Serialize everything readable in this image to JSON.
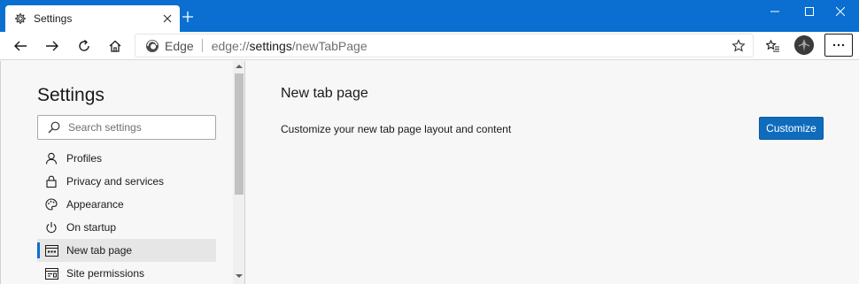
{
  "tab": {
    "title": "Settings"
  },
  "toolbar": {
    "site_name": "Edge",
    "url_prefix": "edge://",
    "url_main": "settings",
    "url_suffix": "/newTabPage"
  },
  "sidebar": {
    "title": "Settings",
    "search_placeholder": "Search settings",
    "items": [
      {
        "label": "Profiles",
        "icon": "person-icon"
      },
      {
        "label": "Privacy and services",
        "icon": "lock-icon"
      },
      {
        "label": "Appearance",
        "icon": "palette-icon"
      },
      {
        "label": "On startup",
        "icon": "power-icon"
      },
      {
        "label": "New tab page",
        "icon": "newtab-icon",
        "active": true
      },
      {
        "label": "Site permissions",
        "icon": "site-permissions-icon"
      }
    ]
  },
  "main": {
    "title": "New tab page",
    "description": "Customize your new tab page layout and content",
    "customize_label": "Customize"
  },
  "colors": {
    "accent": "#0a6fd1",
    "titlebar": "#0a6fd1",
    "button": "#0f6cbd"
  }
}
